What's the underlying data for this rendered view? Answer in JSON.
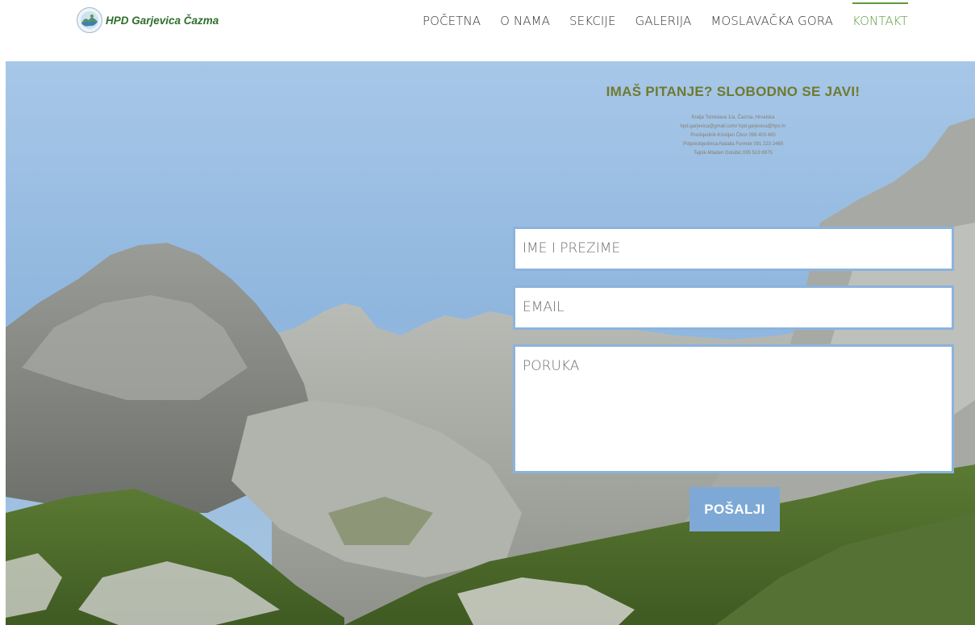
{
  "header": {
    "logo_text": "HPD Garjevica Čazma",
    "nav": [
      {
        "label": "POČETNA",
        "active": false
      },
      {
        "label": "O NAMA",
        "active": false
      },
      {
        "label": "SEKCIJE",
        "active": false
      },
      {
        "label": "GALERIJA",
        "active": false
      },
      {
        "label": "MOSLAVAČKA GORA",
        "active": false
      },
      {
        "label": "KONTAKT",
        "active": true
      }
    ]
  },
  "contact": {
    "title": "IMAŠ PITANJE? SLOBODNO SE JAVI!",
    "info_lines": [
      "Kralja Tomislava 1/a, Čazma, Hrvatska",
      "hpd.garjevica@gmail.com/ hpd.garjevica@hps.hr",
      "Predsjednik-Kristijan Čikor 098 403 465",
      "Potpredsjednica-Natalia Furmek 091 223 2465",
      "Tajnik-Mladen Golubić 095 519 8975"
    ]
  },
  "form": {
    "name_placeholder": "IME I PREZIME",
    "email_placeholder": "EMAIL",
    "message_placeholder": "PORUKA",
    "send_label": "POŠALJI"
  },
  "colors": {
    "accent_green": "#5d9a3b",
    "button_blue": "#7ea9d6",
    "field_border": "#8cb3dc"
  }
}
